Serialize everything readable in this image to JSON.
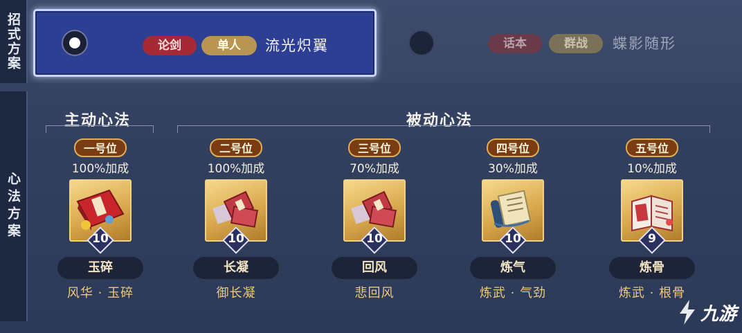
{
  "sections": {
    "moves": "招式方案",
    "mind": "心法方案"
  },
  "schemes": [
    {
      "selected": true,
      "tags": [
        "论剑",
        "单人"
      ],
      "name": "流光炽翼"
    },
    {
      "selected": false,
      "tags": [
        "话本",
        "群战"
      ],
      "name": "蝶影随形"
    }
  ],
  "groups": {
    "active": "主动心法",
    "passive": "被动心法"
  },
  "slots": [
    {
      "position": "一号位",
      "bonus": "100%加成",
      "level": "10",
      "name": "玉碎",
      "source": "风华 · 玉碎",
      "icon": "red-book-icon"
    },
    {
      "position": "二号位",
      "bonus": "100%加成",
      "level": "10",
      "name": "长凝",
      "source": "御长凝",
      "icon": "scattered-scrolls-icon"
    },
    {
      "position": "三号位",
      "bonus": "70%加成",
      "level": "10",
      "name": "回风",
      "source": "悲回风",
      "icon": "scattered-scrolls-icon"
    },
    {
      "position": "四号位",
      "bonus": "30%加成",
      "level": "10",
      "name": "炼气",
      "source": "炼武 · 气劲",
      "icon": "scroll-bundle-icon"
    },
    {
      "position": "五号位",
      "bonus": "10%加成",
      "level": "9",
      "name": "炼骨",
      "source": "炼武 · 根骨",
      "icon": "open-book-icon"
    }
  ],
  "colors": {
    "tag_red": "#a52a36",
    "tag_gold": "#b89553",
    "selected_bg": "#2d3f93",
    "badge_border": "#e1ae57"
  },
  "watermark": "九游"
}
